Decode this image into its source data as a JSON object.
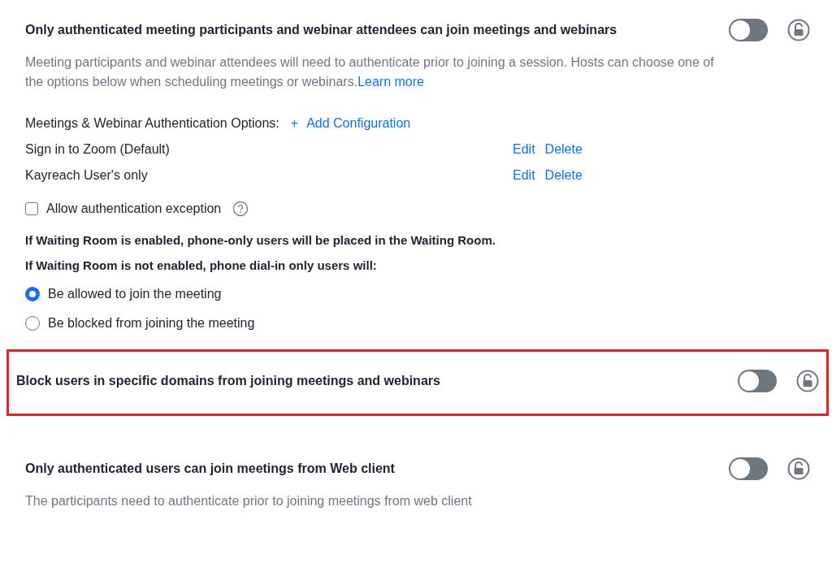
{
  "settings": [
    {
      "title": "Only authenticated meeting participants and webinar attendees can join meetings and webinars",
      "on": false,
      "locked": false,
      "highlighted": false,
      "description": "Meeting participants and webinar attendees will need to authenticate prior to joining a session. Hosts can choose one of the options below when scheduling meetings or webinars.",
      "link": "Learn more",
      "auth_options": {
        "label": "Meetings & Webinar Authentication Options:",
        "add_icon": "+",
        "add_link": "Add Configuration",
        "configurations": [
          {
            "name": "Sign in to Zoom (Default)",
            "actions": [
              "Edit",
              "Delete"
            ]
          },
          {
            "name": "Kayreach User's only",
            "actions": [
              "Edit",
              "Delete"
            ]
          }
        ]
      },
      "exception": {
        "label": "Allow authentication exception",
        "checked": false
      },
      "notes": [
        "If Waiting Room is enabled, phone-only users will be placed in the Waiting Room.",
        "If Waiting Room is not enabled, phone dial-in only users will:"
      ],
      "radios": [
        {
          "label": "Be allowed to join the meeting",
          "selected": true
        },
        {
          "label": "Be blocked from joining the meeting",
          "selected": false
        }
      ]
    },
    {
      "title": "Block users in specific domains from joining meetings and webinars",
      "on": false,
      "locked": false,
      "highlighted": true
    },
    {
      "title": "Only authenticated users can join meetings from Web client",
      "on": false,
      "locked": false,
      "highlighted": false,
      "description": "The participants need to authenticate prior to joining meetings from web client"
    }
  ]
}
